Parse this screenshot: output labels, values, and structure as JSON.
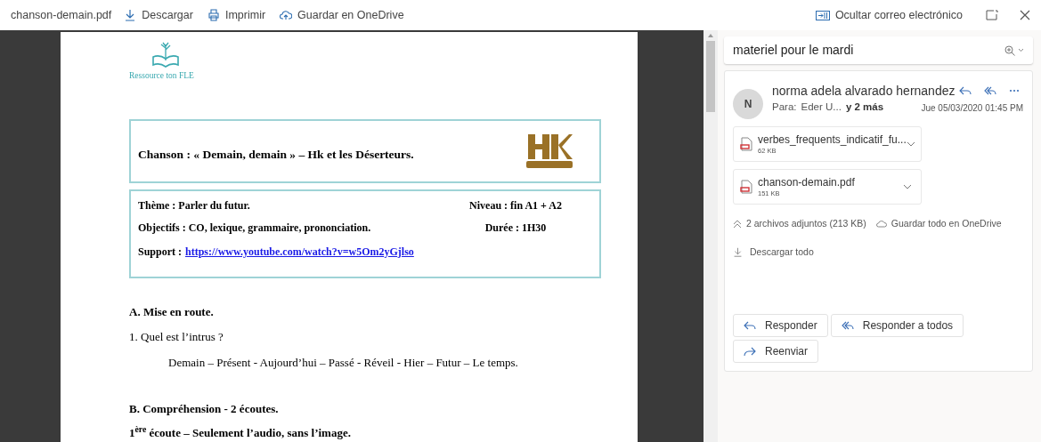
{
  "toolbar": {
    "file_name": "chanson-demain.pdf",
    "actions": [
      {
        "kind": "download",
        "label": "Descargar"
      },
      {
        "kind": "print",
        "label": "Imprimir"
      },
      {
        "kind": "cloud",
        "label": "Guardar en OneDrive"
      }
    ],
    "hide_mail": "Ocultar correo electrónico"
  },
  "document": {
    "logo_caption": "Ressource ton FLE",
    "title": "Chanson : « Demain, demain » – Hk et les Déserteurs.",
    "info": [
      {
        "left": "Thème : Parler du futur.",
        "right": "Niveau : fin A1 + A2"
      },
      {
        "left": "Objectifs : CO, lexique, grammaire, prononciation.",
        "right": "Durée : 1H30"
      }
    ],
    "support_label": "Support :",
    "support_link": "https://www.youtube.com/watch?v=w5Om2yGjlso",
    "body": [
      {
        "kind": "heading",
        "text": "A. Mise en route."
      },
      {
        "kind": "text",
        "text": "1. Quel est l’intrus ?"
      },
      {
        "kind": "indented",
        "text": "Demain – Présent - Aujourd’hui – Passé - Réveil - Hier – Futur – Le temps."
      },
      {
        "kind": "heading",
        "text": "B. Compréhension - 2 écoutes."
      },
      {
        "kind": "heading",
        "text": "1$^{ère}$ écoute – Seulement l’audio, sans l’image."
      }
    ]
  },
  "mail": {
    "subject": "materiel pour le mardi",
    "avatar": "N",
    "sender": "norma adela alvarado hernandez",
    "to_label": "Para:",
    "to": "Eder U...",
    "more": "y 2 más",
    "date": "Jue 05/03/2020 01:45 PM",
    "attachments": [
      {
        "name": "verbes_frequents_indicatif_fu...",
        "size": "62 KB"
      },
      {
        "name": "chanson-demain.pdf",
        "size": "151 KB"
      }
    ],
    "summary": "2 archivos adjuntos (213 KB)",
    "save_all": "Guardar todo en OneDrive",
    "download_all": "Descargar todo",
    "buttons": [
      {
        "kind": "reply",
        "label": "Responder"
      },
      {
        "kind": "reply_all",
        "label": "Responder a todos"
      },
      {
        "kind": "forward",
        "label": "Reenviar"
      }
    ]
  }
}
